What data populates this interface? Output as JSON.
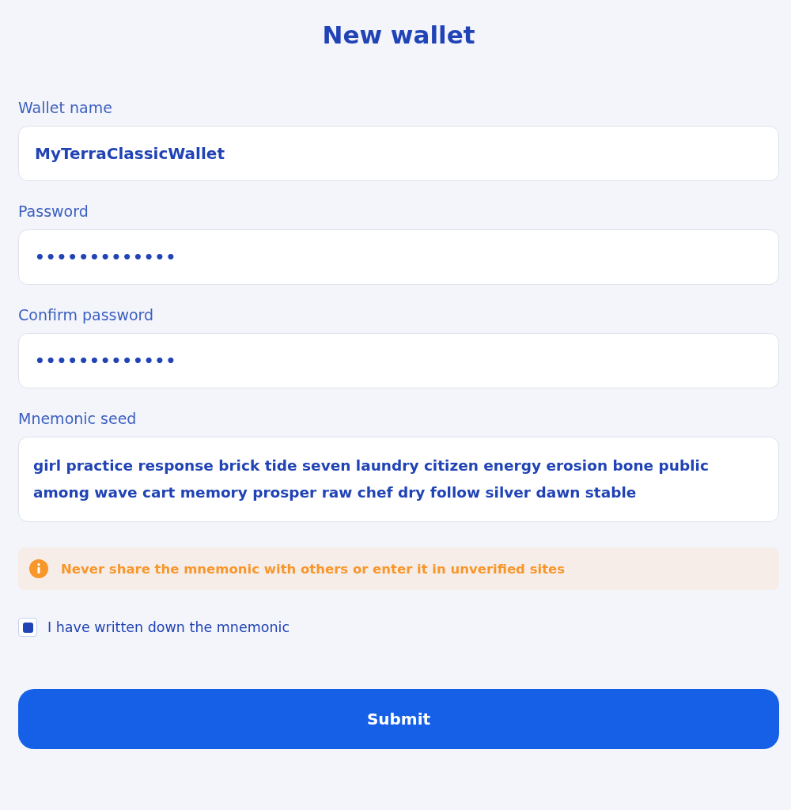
{
  "title": "New wallet",
  "fields": [
    {
      "label": "Wallet name",
      "value": "MyTerraClassicWallet",
      "kind": "text"
    },
    {
      "label": "Password",
      "value": "•••••••••••••",
      "kind": "password"
    },
    {
      "label": "Confirm password",
      "value": "•••••••••••••",
      "kind": "password"
    },
    {
      "label": "Mnemonic seed",
      "value": "girl practice response brick tide seven laundry citizen energy erosion bone public among wave cart memory prosper raw chef dry follow silver dawn stable",
      "kind": "textarea"
    }
  ],
  "warning": "Never share the mnemonic with others or enter it in unverified sites",
  "checkbox": {
    "label": "I have written down the mnemonic",
    "checked": true
  },
  "submit": "Submit"
}
